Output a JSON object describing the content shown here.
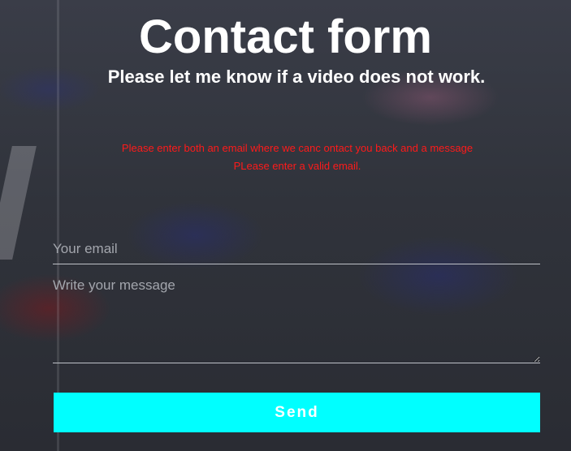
{
  "header": {
    "title": "Contact form",
    "subtitle": "Please let me know if a video does not work."
  },
  "errors": [
    "Please enter both an email where we canc ontact you back and a message",
    "PLease enter a valid email."
  ],
  "form": {
    "email_placeholder": "Your email",
    "message_placeholder": "Write your message",
    "send_label": "Send"
  },
  "colors": {
    "error_text": "#ff1a1a",
    "send_button_bg": "#00ffff",
    "background": "#2f323a"
  }
}
